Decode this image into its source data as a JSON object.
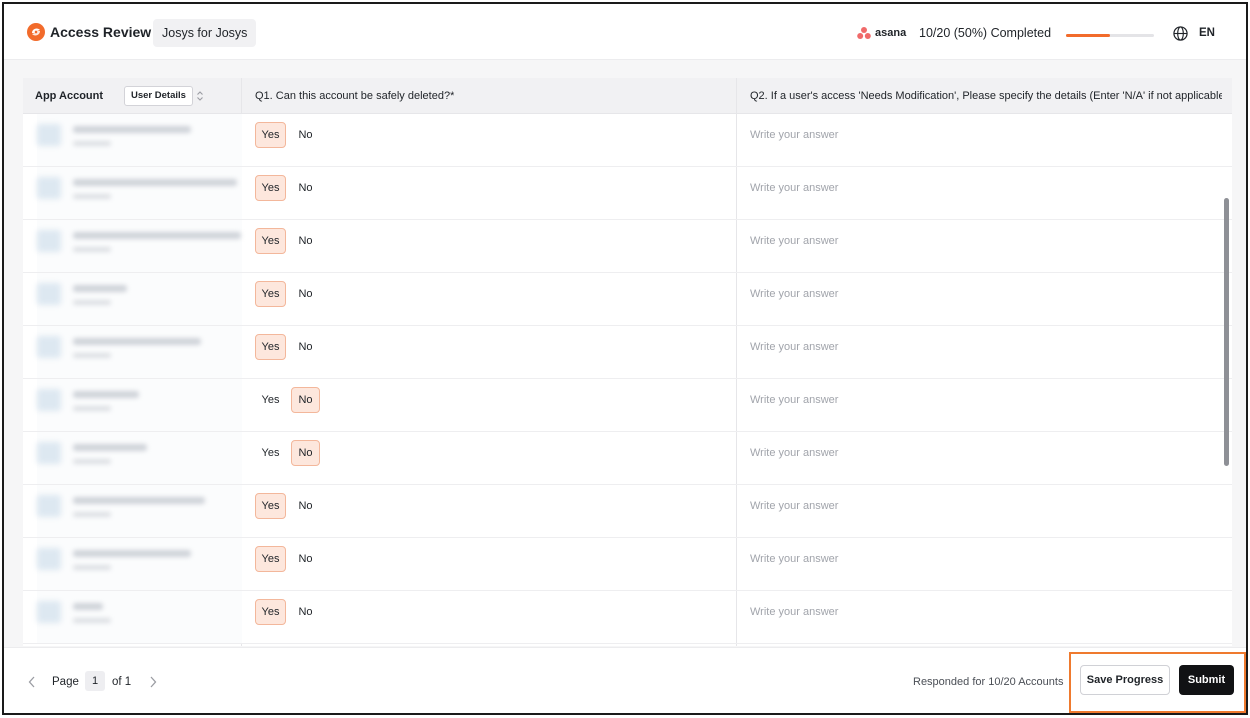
{
  "header": {
    "title": "Access Review",
    "org": "Josys for Josys",
    "app_name": "asana",
    "progress_text": "10/20 (50%) Completed",
    "progress_fraction": 0.5,
    "language": "EN",
    "icons": [
      "josys-logo-icon",
      "asana-logo-icon",
      "globe-icon"
    ]
  },
  "table": {
    "columns": {
      "app_account": "App Account",
      "user_details": "User Details",
      "q1": "Q1. Can this account be safely deleted?*",
      "q2": "Q2. If a user's access 'Needs Modification', Please specify the details (Enter 'N/A' if not applicable"
    },
    "yes_label": "Yes",
    "no_label": "No",
    "answer_placeholder": "Write your answer",
    "rows": [
      {
        "q1": "Yes"
      },
      {
        "q1": "Yes"
      },
      {
        "q1": "Yes"
      },
      {
        "q1": "Yes"
      },
      {
        "q1": "Yes"
      },
      {
        "q1": "No"
      },
      {
        "q1": "No"
      },
      {
        "q1": "Yes"
      },
      {
        "q1": "Yes"
      },
      {
        "q1": "Yes"
      }
    ]
  },
  "footer": {
    "page_label": "Page",
    "page_number": "1",
    "of_label": "of 1",
    "responded": "Responded for 10/20 Accounts",
    "save_label": "Save Progress",
    "submit_label": "Submit"
  },
  "colors": {
    "accent": "#f26b2b",
    "selected_bg": "#fde7dd",
    "selected_border": "#f3b79b",
    "submit_bg": "#111214",
    "highlight_box": "#ef7a2e"
  }
}
